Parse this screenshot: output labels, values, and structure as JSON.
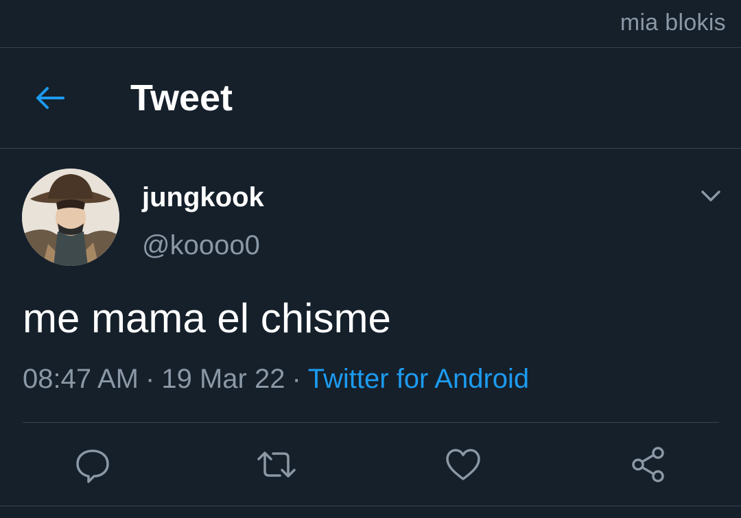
{
  "watermark": "mia blokis",
  "header": {
    "title": "Tweet",
    "back_icon": "arrow-left-icon"
  },
  "tweet": {
    "author": {
      "name": "jungkook",
      "handle": "@koooo0",
      "avatar": "profile-photo"
    },
    "text": "me mama el chisme",
    "time": "08:47 AM",
    "date": "19 Mar 22",
    "source": "Twitter for Android",
    "separator": "·"
  },
  "actions": [
    "reply-icon",
    "retweet-icon",
    "like-icon",
    "share-icon"
  ],
  "colors": {
    "background": "#15202b",
    "accent": "#1d9bf0",
    "muted": "#8b98a5",
    "divider": "#38444d"
  }
}
